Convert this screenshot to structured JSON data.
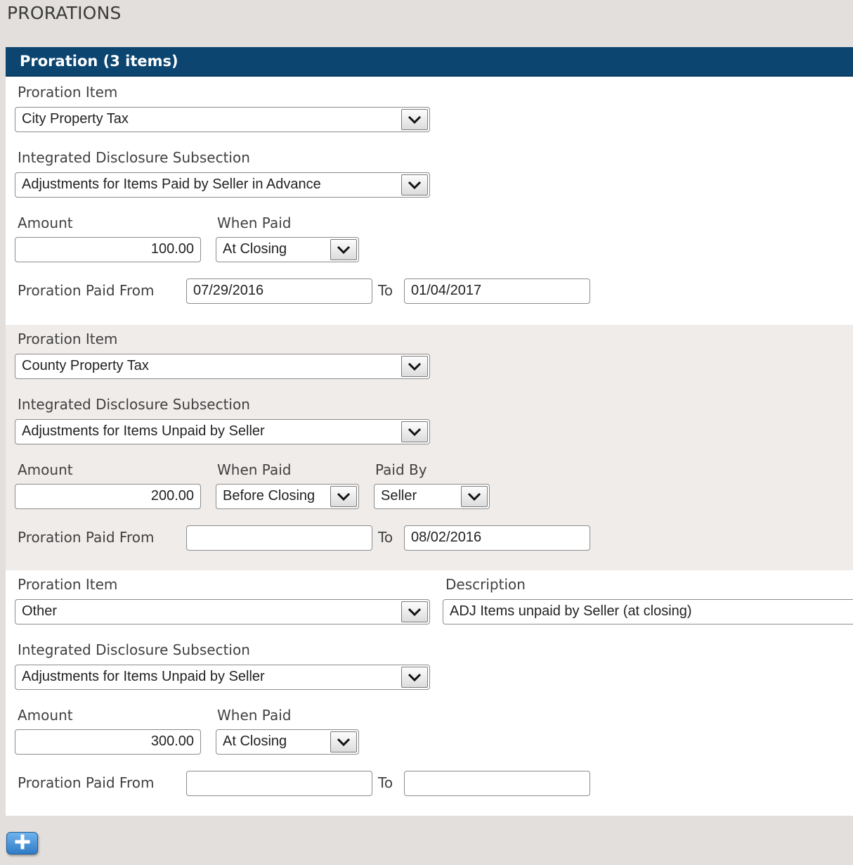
{
  "page": {
    "title": "PRORATIONS"
  },
  "panel": {
    "header": "Proration (3 items)"
  },
  "labels": {
    "proration_item": "Proration Item",
    "subsection": "Integrated Disclosure Subsection",
    "amount": "Amount",
    "when_paid": "When Paid",
    "paid_by": "Paid By",
    "paid_from": "Proration Paid From",
    "to": "To",
    "description": "Description"
  },
  "items": [
    {
      "proration_item": "City Property Tax",
      "subsection": "Adjustments for Items Paid by Seller in Advance",
      "amount": "100.00",
      "when_paid": "At Closing",
      "paid_from": "07/29/2016",
      "paid_to": "01/04/2017"
    },
    {
      "proration_item": "County Property Tax",
      "subsection": "Adjustments for Items Unpaid by Seller",
      "amount": "200.00",
      "when_paid": "Before Closing",
      "paid_by": "Seller",
      "paid_from": "",
      "paid_to": "08/02/2016"
    },
    {
      "proration_item": "Other",
      "description": "ADJ Items unpaid by Seller (at closing)",
      "subsection": "Adjustments for Items Unpaid by Seller",
      "amount": "300.00",
      "when_paid": "At Closing",
      "paid_from": "",
      "paid_to": ""
    }
  ],
  "icons": {
    "dropdown": "chevron-down-icon",
    "add": "plus-icon"
  },
  "colors": {
    "header_bg": "#0b4570",
    "add_button": "#2f7cc7",
    "shaded_row": "#f0ecea"
  }
}
